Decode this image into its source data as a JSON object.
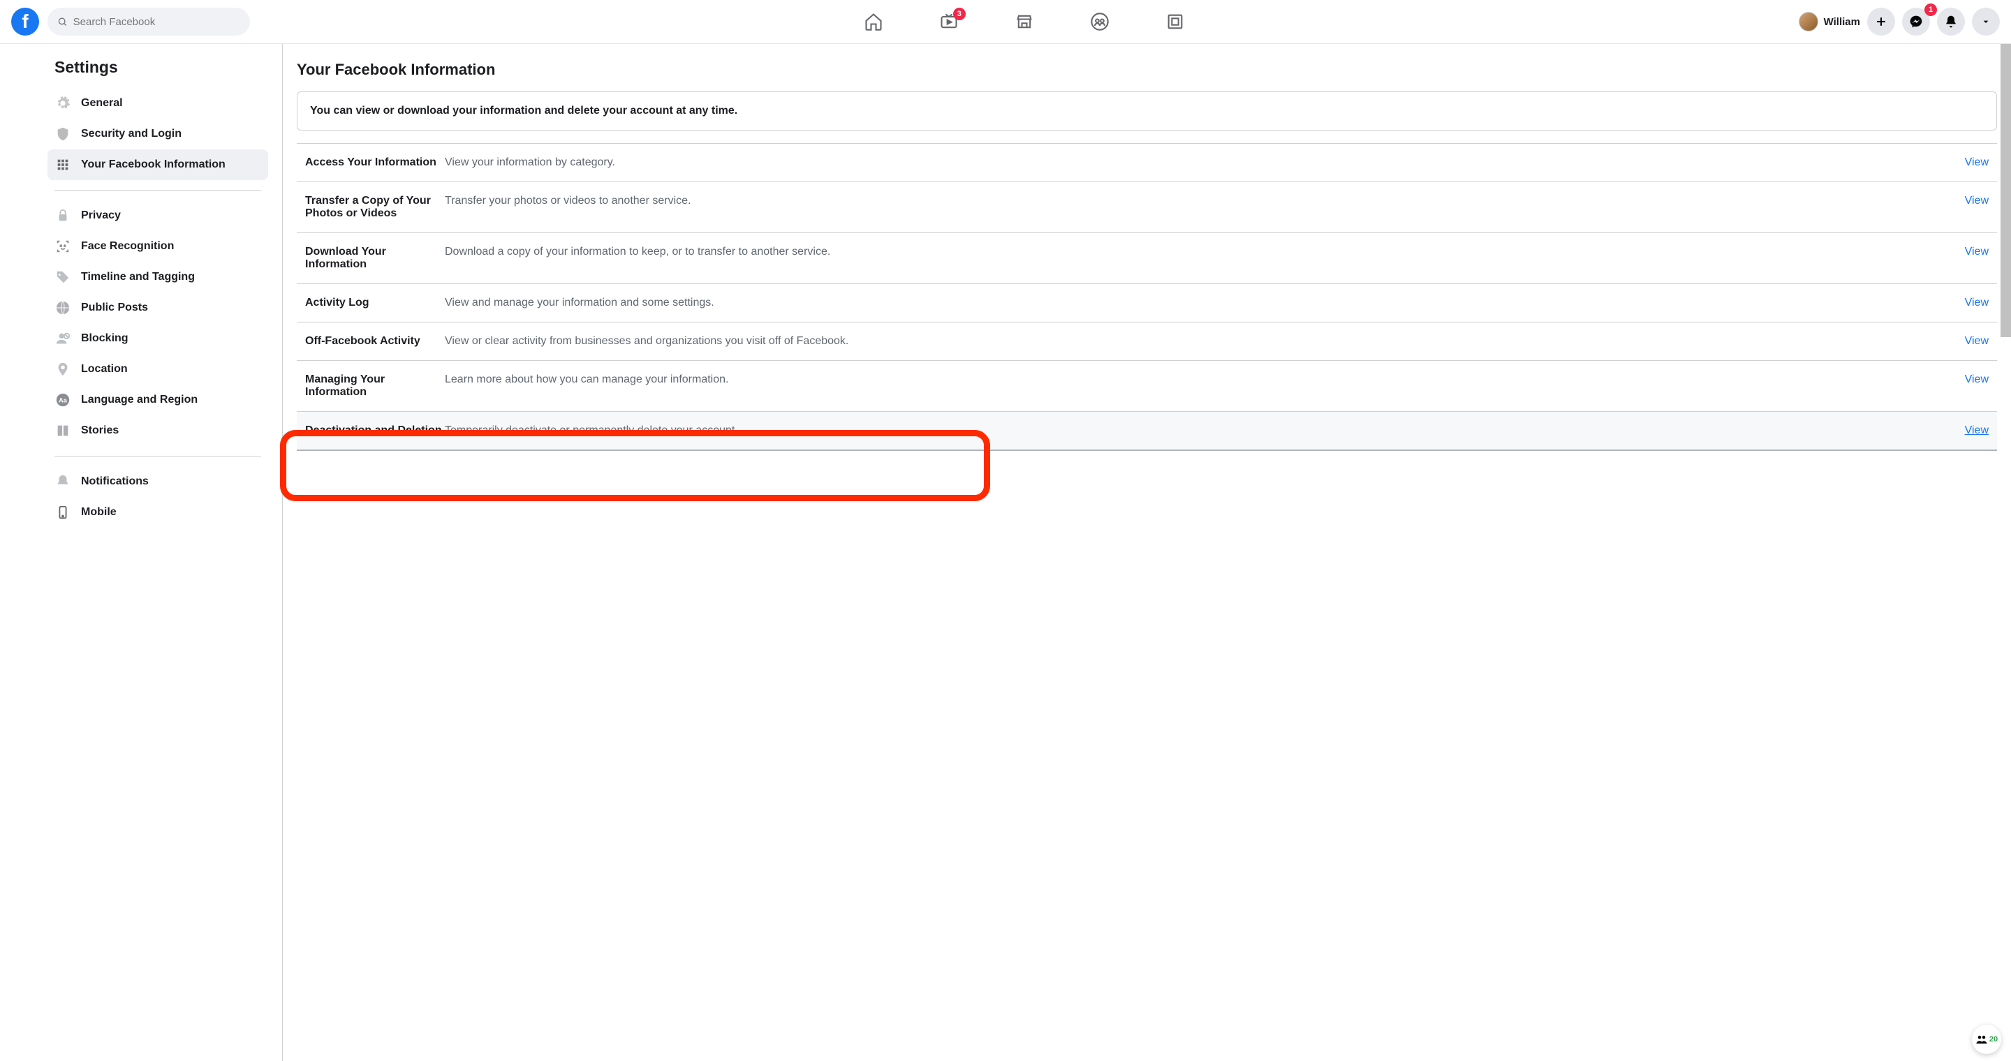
{
  "header": {
    "search_placeholder": "Search Facebook",
    "watch_badge": "3",
    "user_name": "William",
    "messenger_badge": "1"
  },
  "sidebar": {
    "title": "Settings",
    "items": [
      {
        "label": "General"
      },
      {
        "label": "Security and Login"
      },
      {
        "label": "Your Facebook Information"
      },
      {
        "label": "Privacy"
      },
      {
        "label": "Face Recognition"
      },
      {
        "label": "Timeline and Tagging"
      },
      {
        "label": "Public Posts"
      },
      {
        "label": "Blocking"
      },
      {
        "label": "Location"
      },
      {
        "label": "Language and Region"
      },
      {
        "label": "Stories"
      },
      {
        "label": "Notifications"
      },
      {
        "label": "Mobile"
      }
    ]
  },
  "main": {
    "title": "Your Facebook Information",
    "subtitle": "You can view or download your information and delete your account at any time.",
    "view_label": "View",
    "rows": [
      {
        "title": "Access Your Information",
        "desc": "View your information by category."
      },
      {
        "title": "Transfer a Copy of Your Photos or Videos",
        "desc": "Transfer your photos or videos to another service."
      },
      {
        "title": "Download Your Information",
        "desc": "Download a copy of your information to keep, or to transfer to another service."
      },
      {
        "title": "Activity Log",
        "desc": "View and manage your information and some settings."
      },
      {
        "title": "Off-Facebook Activity",
        "desc": "View or clear activity from businesses and organizations you visit off of Facebook."
      },
      {
        "title": "Managing Your Information",
        "desc": "Learn more about how you can manage your information."
      },
      {
        "title": "Deactivation and Deletion",
        "desc": "Temporarily deactivate or permanently delete your account."
      }
    ]
  },
  "widget": {
    "count": "20"
  }
}
